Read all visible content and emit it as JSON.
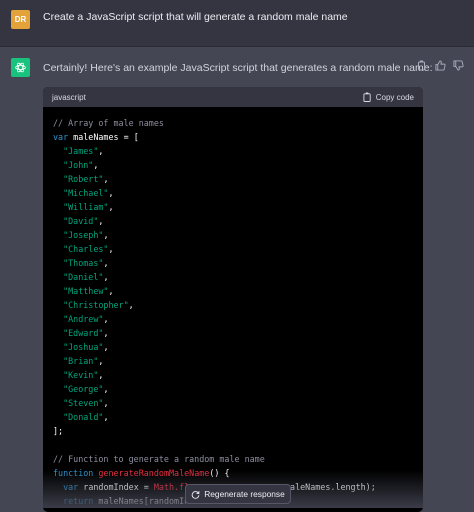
{
  "user_message": {
    "avatar_initials": "DR",
    "text": "Create a JavaScript script that will generate a random male name"
  },
  "assistant_message": {
    "text": "Certainly! Here's an example JavaScript script that generates a random male name:",
    "actions": [
      "copy-icon",
      "thumbs-up-icon",
      "thumbs-down-icon"
    ]
  },
  "code_block": {
    "language": "javascript",
    "copy_label": "Copy code",
    "comment_array": "// Array of male names",
    "names": [
      "James",
      "John",
      "Robert",
      "Michael",
      "William",
      "David",
      "Joseph",
      "Charles",
      "Thomas",
      "Daniel",
      "Matthew",
      "Christopher",
      "Andrew",
      "Edward",
      "Joshua",
      "Brian",
      "Kevin",
      "George",
      "Steven",
      "Donald"
    ],
    "comment_function": "// Function to generate a random male name",
    "function_name": "generateRandomMaleName",
    "line_random_partial_a": "randomIndex = ",
    "line_random_math": "Math",
    "line_random_floor": ".fl",
    "line_random_tail": "aleNames.length);",
    "line_return_partial": "maleNames[randomIn"
  },
  "regenerate_label": "Regenerate response",
  "colors": {
    "user_bg": "#343541",
    "assistant_bg": "#444654",
    "code_bg": "#000000",
    "accent_green": "#19c37d",
    "avatar_orange": "#e4a23b"
  }
}
